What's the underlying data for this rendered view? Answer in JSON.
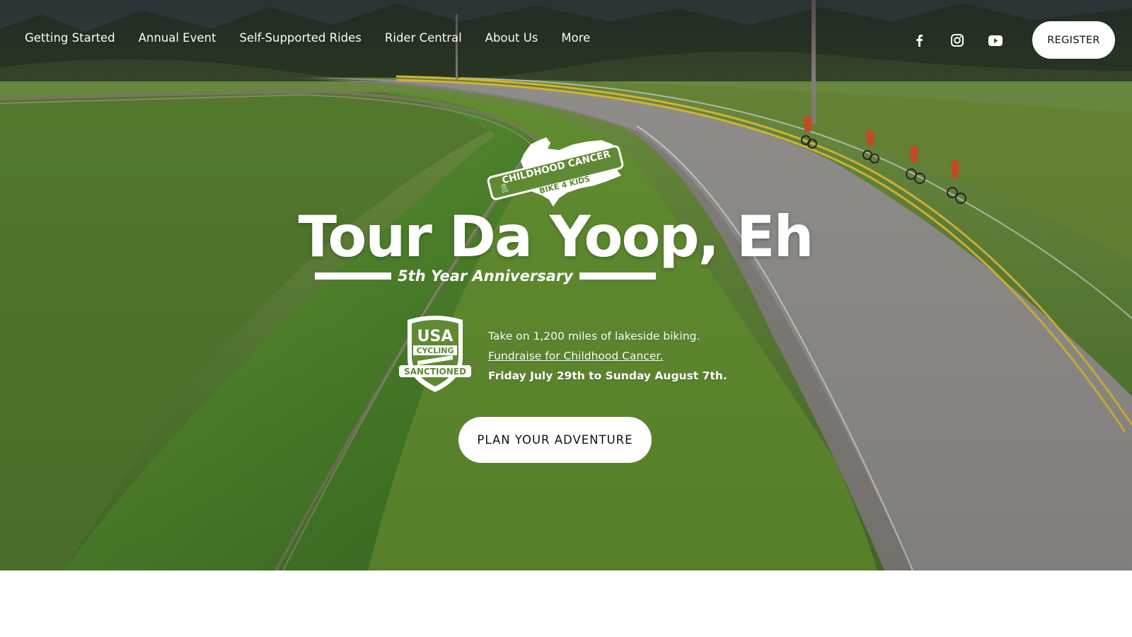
{
  "nav": {
    "items": [
      {
        "label": "Getting Started"
      },
      {
        "label": "Annual Event"
      },
      {
        "label": "Self-Supported Rides"
      },
      {
        "label": "Rider Central"
      },
      {
        "label": "About Us"
      },
      {
        "label": "More"
      }
    ],
    "social": [
      "facebook-icon",
      "instagram-icon",
      "youtube-icon"
    ],
    "register_label": "REGISTER"
  },
  "hero": {
    "logo_text": {
      "line1": "CHILDHOOD CANCER",
      "line2": "BIKE 4 KIDS"
    },
    "title": "Tour Da Yoop, Eh",
    "subtitle": "5th Year Anniversary",
    "badge_text": {
      "line1": "USA",
      "line2": "CYCLING",
      "line3": "SANCTIONED"
    },
    "info": {
      "line1": "Take on 1,200 miles of lakeside biking.",
      "link": "Fundraise for Childhood Cancer.",
      "dates": "Friday July 29th to Sunday August 7th."
    },
    "cta_label": "PLAN YOUR ADVENTURE"
  },
  "colors": {
    "grass": "#5f8a33",
    "road": "#9d9b98",
    "road_line": "#e9c53a",
    "button_bg": "#ffffff",
    "button_text": "#111111"
  }
}
